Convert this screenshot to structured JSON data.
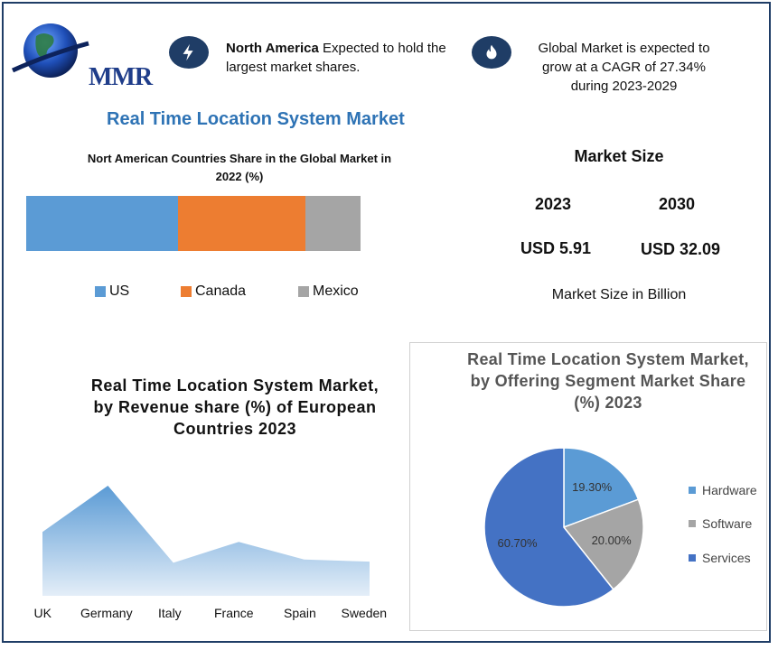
{
  "brand": {
    "logo_text": "MMR"
  },
  "highlights": [
    {
      "icon": "lightning-icon",
      "bold": "North America",
      "rest": " Expected to hold the",
      "line2": "largest market shares."
    },
    {
      "icon": "flame-icon",
      "line1": "Global Market is expected to",
      "line2": "grow at a CAGR of 27.34%",
      "line3": "during 2023-2029"
    }
  ],
  "main_title": "Real Time Location System Market",
  "bar_chart": {
    "title_line1": "Nort American Countries Share in the Global Market in",
    "title_line2": "2022 (%)"
  },
  "market_size": {
    "title": "Market Size",
    "year1": "2023",
    "year2": "2030",
    "value1": "USD 5.91",
    "value2": "USD 32.09",
    "note": "Market Size in Billion"
  },
  "area_chart_title": {
    "line1": "Real Time Location System Market,",
    "line2": "by Revenue share (%) of European",
    "line3": "Countries 2023"
  },
  "pie_chart_title": {
    "line1": "Real Time Location System Market,",
    "line2": "by Offering Segment Market Share",
    "line3": "(%) 2023"
  },
  "colors": {
    "us": "#5b9bd5",
    "canada": "#ed7d31",
    "mexico": "#a5a5a5",
    "hardware": "#5b9bd5",
    "software": "#a5a5a5",
    "services": "#4472c4",
    "accent": "#2e73b5",
    "navy": "#1f3d66"
  },
  "chart_data": [
    {
      "type": "bar",
      "orientation": "horizontal-stacked",
      "title": "Nort American Countries Share in the Global Market in 2022 (%)",
      "series": [
        {
          "name": "US",
          "values": [
            45.5
          ]
        },
        {
          "name": "Canada",
          "values": [
            38
          ]
        },
        {
          "name": "Mexico",
          "values": [
            16.5
          ]
        }
      ],
      "legend": "bottom"
    },
    {
      "type": "area",
      "title": "Real Time Location System Market, by Revenue share (%) of European Countries 2023",
      "categories": [
        "UK",
        "Germany",
        "Italy",
        "France",
        "Spain",
        "Sweden"
      ],
      "values": [
        58,
        100,
        30,
        49,
        33,
        31
      ],
      "grid": false
    },
    {
      "type": "pie",
      "title": "Real Time Location System Market, by Offering Segment Market Share (%) 2023",
      "categories": [
        "Hardware",
        "Software",
        "Services"
      ],
      "values": [
        19.3,
        20.0,
        60.7
      ],
      "labels": [
        "19.30%",
        "20.00%",
        "60.70%"
      ],
      "legend": "right"
    }
  ]
}
